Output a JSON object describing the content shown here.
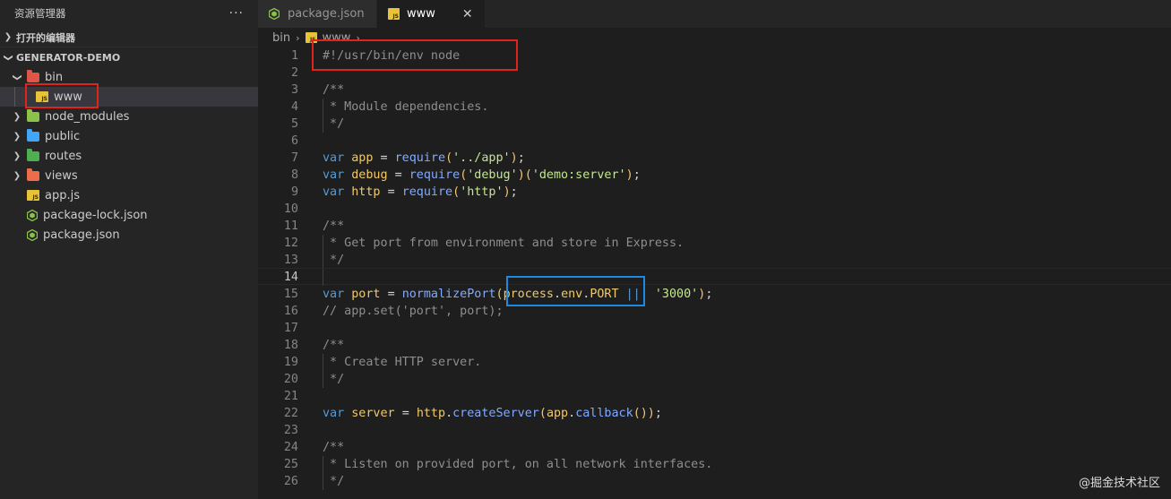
{
  "sidebar": {
    "title": "资源管理器",
    "more_label": "···",
    "open_editors_label": "打开的编辑器",
    "project_label": "GENERATOR-DEMO",
    "tree": [
      {
        "label": "bin",
        "kind": "folder",
        "expanded": true,
        "icon": "folder-bin-icon"
      },
      {
        "label": "www",
        "kind": "js-file",
        "selected": true,
        "icon": "js-file-icon"
      },
      {
        "label": "node_modules",
        "kind": "folder",
        "expanded": false,
        "icon": "folder-node-icon"
      },
      {
        "label": "public",
        "kind": "folder",
        "expanded": false,
        "icon": "folder-public-icon"
      },
      {
        "label": "routes",
        "kind": "folder",
        "expanded": false,
        "icon": "folder-routes-icon"
      },
      {
        "label": "views",
        "kind": "folder",
        "expanded": false,
        "icon": "folder-views-icon"
      },
      {
        "label": "app.js",
        "kind": "js-file",
        "icon": "js-file-icon"
      },
      {
        "label": "package-lock.json",
        "kind": "node-file",
        "icon": "node-json-icon"
      },
      {
        "label": "package.json",
        "kind": "node-file",
        "icon": "node-json-icon"
      }
    ]
  },
  "tabs": [
    {
      "label": "package.json",
      "active": false,
      "icon": "node-json-icon"
    },
    {
      "label": "www",
      "active": true,
      "icon": "js-file-icon",
      "close": "✕"
    }
  ],
  "breadcrumb": {
    "part1": "bin",
    "sep": "›",
    "part2": "www",
    "part3": "..."
  },
  "editor": {
    "current_line": 14,
    "lines": [
      {
        "n": "1",
        "text": "#!/usr/bin/env node"
      },
      {
        "n": "2",
        "text": ""
      },
      {
        "n": "3",
        "text": "/**"
      },
      {
        "n": "4",
        "text": " * Module dependencies."
      },
      {
        "n": "5",
        "text": " */"
      },
      {
        "n": "6",
        "text": ""
      },
      {
        "n": "7",
        "text": "var app = require('../app');"
      },
      {
        "n": "8",
        "text": "var debug = require('debug')('demo:server');"
      },
      {
        "n": "9",
        "text": "var http = require('http');"
      },
      {
        "n": "10",
        "text": ""
      },
      {
        "n": "11",
        "text": "/**"
      },
      {
        "n": "12",
        "text": " * Get port from environment and store in Express."
      },
      {
        "n": "13",
        "text": " */"
      },
      {
        "n": "14",
        "text": ""
      },
      {
        "n": "15",
        "text": "var port = normalizePort(process.env.PORT || '3000');"
      },
      {
        "n": "16",
        "text": "// app.set('port', port);"
      },
      {
        "n": "17",
        "text": ""
      },
      {
        "n": "18",
        "text": "/**"
      },
      {
        "n": "19",
        "text": " * Create HTTP server."
      },
      {
        "n": "20",
        "text": " */"
      },
      {
        "n": "21",
        "text": ""
      },
      {
        "n": "22",
        "text": "var server = http.createServer(app.callback());"
      },
      {
        "n": "23",
        "text": ""
      },
      {
        "n": "24",
        "text": "/**"
      },
      {
        "n": "25",
        "text": " * Listen on provided port, on all network interfaces."
      },
      {
        "n": "26",
        "text": " */"
      }
    ]
  },
  "watermark": "@掘金技术社区",
  "colors": {
    "annotation_red": "#e0241b",
    "annotation_blue": "#1e88e5",
    "editor_bg": "#1e1e1e",
    "sidebar_bg": "#252526"
  }
}
